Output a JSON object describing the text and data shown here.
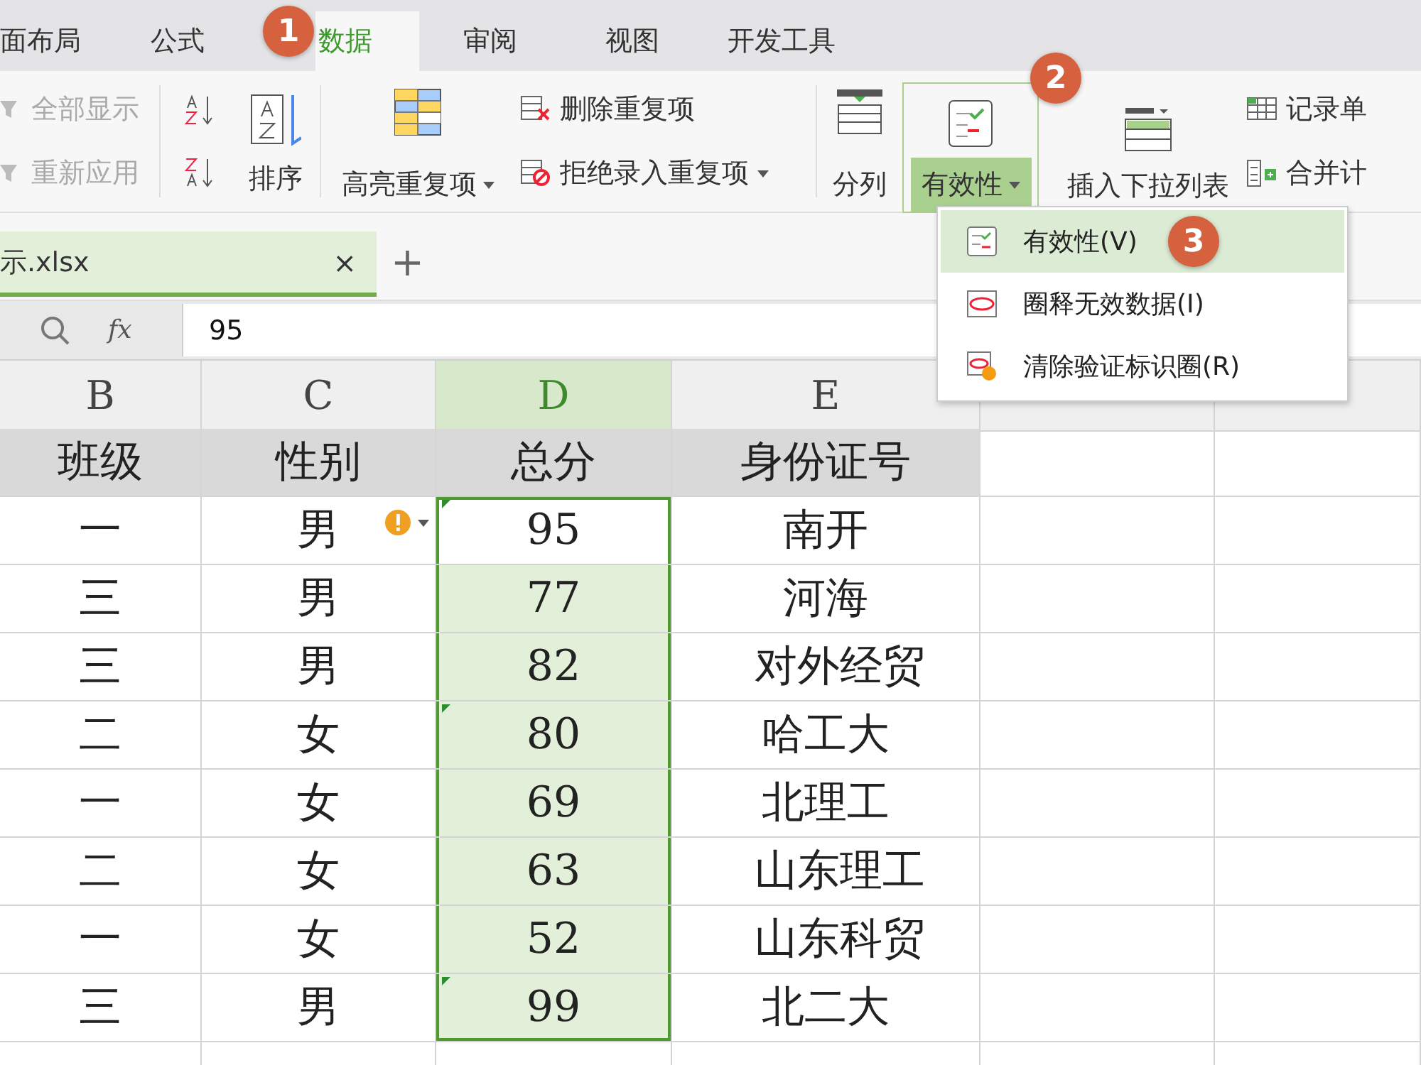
{
  "ribbon_tabs": [
    {
      "label": "面布局",
      "selected": false
    },
    {
      "label": "公式",
      "selected": false
    },
    {
      "label": "数据",
      "selected": true,
      "badge": "1"
    },
    {
      "label": "审阅",
      "selected": false
    },
    {
      "label": "视图",
      "selected": false
    },
    {
      "label": "开发工具",
      "selected": false
    }
  ],
  "ribbon": {
    "filter_items": [
      {
        "label": "全部显示",
        "disabled": true
      },
      {
        "label": "重新应用",
        "disabled": true
      }
    ],
    "sort": {
      "label": "排序"
    },
    "highlight": {
      "label": "高亮重复项"
    },
    "duplicates": [
      {
        "label": "删除重复项",
        "kind": "delete"
      },
      {
        "label": "拒绝录入重复项",
        "kind": "reject"
      }
    ],
    "split": {
      "label": "分列"
    },
    "validation": {
      "label": "有效性",
      "expanded": true,
      "badge": "2"
    },
    "insert_list": {
      "label": "插入下拉列表"
    },
    "right_items": [
      {
        "label": "记录单",
        "kind": "record"
      },
      {
        "label": "合并计",
        "kind": "merge"
      }
    ]
  },
  "validation_menu": [
    {
      "label": "有效性(V)",
      "selected": true,
      "badge": "3",
      "kind": "validate"
    },
    {
      "label": "圈释无效数据(I)",
      "selected": false,
      "kind": "circle"
    },
    {
      "label": "清除验证标识圈(R)",
      "selected": false,
      "kind": "clear"
    }
  ],
  "doc_tabs": [
    {
      "label": "示.xlsx",
      "selected": true,
      "close": "×"
    }
  ],
  "new_tab": "+",
  "formula_bar": {
    "fx": "fx",
    "value": "95"
  },
  "sheet": {
    "columns": [
      {
        "label": "B",
        "selected": false
      },
      {
        "label": "C",
        "selected": false
      },
      {
        "label": "D",
        "selected": true
      },
      {
        "label": "E",
        "selected": false
      }
    ],
    "header_row": [
      "班级",
      "性别",
      "总分",
      "身份证号"
    ],
    "rows": [
      {
        "cells": [
          "一",
          "男",
          "95",
          "南开"
        ],
        "active": true,
        "warning": true,
        "flag": true
      },
      {
        "cells": [
          "三",
          "男",
          "77",
          "河海"
        ],
        "active": false,
        "warning": false,
        "flag": false
      },
      {
        "cells": [
          "三",
          "男",
          "82",
          "对外经贸"
        ],
        "active": false,
        "warning": false,
        "flag": false
      },
      {
        "cells": [
          "二",
          "女",
          "80",
          "哈工大"
        ],
        "active": false,
        "warning": false,
        "flag": true
      },
      {
        "cells": [
          "一",
          "女",
          "69",
          "北理工"
        ],
        "active": false,
        "warning": false,
        "flag": false
      },
      {
        "cells": [
          "二",
          "女",
          "63",
          "山东理工"
        ],
        "active": false,
        "warning": false,
        "flag": false
      },
      {
        "cells": [
          "一",
          "女",
          "52",
          "山东科贸"
        ],
        "active": false,
        "warning": false,
        "flag": false
      },
      {
        "cells": [
          "三",
          "男",
          "99",
          "北二大"
        ],
        "active": false,
        "warning": false,
        "flag": true
      }
    ]
  }
}
